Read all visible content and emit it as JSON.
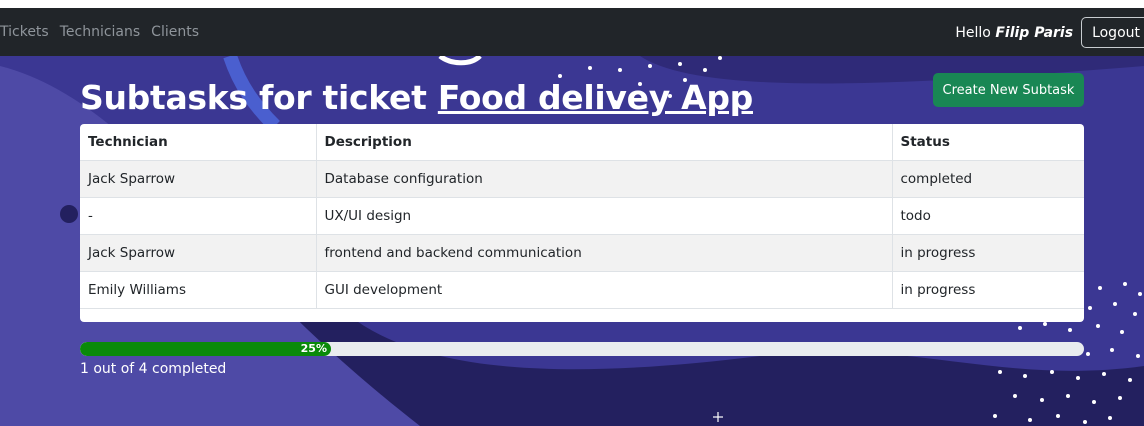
{
  "nav": {
    "links": [
      "Tickets",
      "Technicians",
      "Clients"
    ],
    "greeting": "Hello",
    "user_name": "Filip Paris",
    "logout_label": "Logout"
  },
  "page": {
    "title_prefix": "Subtasks for ticket",
    "ticket_name": "Food delivey App",
    "create_button_label": "Create New Subtask"
  },
  "table": {
    "headers": [
      "Technician",
      "Description",
      "Status"
    ],
    "rows": [
      [
        "Jack Sparrow",
        "Database configuration",
        "completed"
      ],
      [
        "-",
        "UX/UI design",
        "todo"
      ],
      [
        "Jack Sparrow",
        "frontend and backend communication",
        "in progress"
      ],
      [
        "Emily Williams",
        "GUI development",
        "in progress"
      ]
    ]
  },
  "progress": {
    "percent": 25,
    "label": "25%",
    "caption": "1 out of 4 completed"
  },
  "colors": {
    "navbar": "#212529",
    "background": "#3a3a8f",
    "accent_green": "#198754",
    "progress_green": "#0a8a0a"
  }
}
